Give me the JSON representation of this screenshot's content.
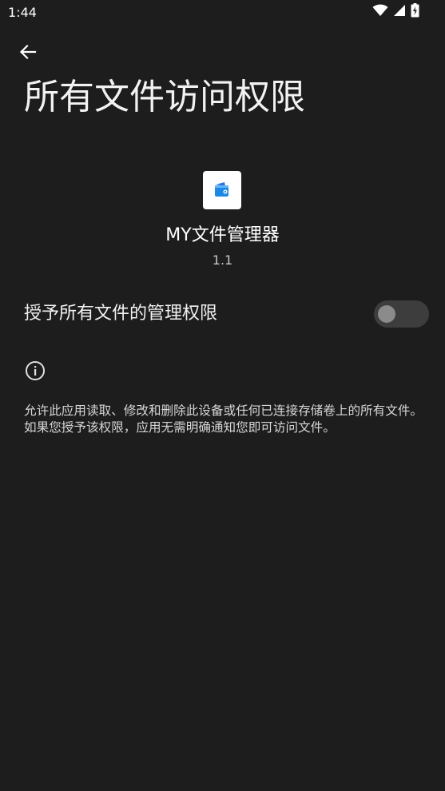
{
  "status_bar": {
    "time": "1:44",
    "icons": [
      "wifi-icon",
      "signal-icon",
      "battery-icon"
    ]
  },
  "header": {
    "back_icon": "arrow-left-icon",
    "title": "所有文件访问权限"
  },
  "app": {
    "icon": "file-manager-app-icon",
    "name": "MY文件管理器",
    "version": "1.1"
  },
  "permission": {
    "label": "授予所有文件的管理权限",
    "enabled": false
  },
  "info": {
    "icon": "info-icon",
    "text": "允许此应用读取、修改和删除此设备或任何已连接存储卷上的所有文件。如果您授予该权限，应用无需明确通知您即可访问文件。"
  },
  "colors": {
    "background": "#1d1d1d",
    "text_primary": "#ffffff",
    "text_secondary": "#c6c6c6",
    "switch_track_off": "#3d3d3d",
    "switch_thumb_off": "#8b8b8b"
  }
}
